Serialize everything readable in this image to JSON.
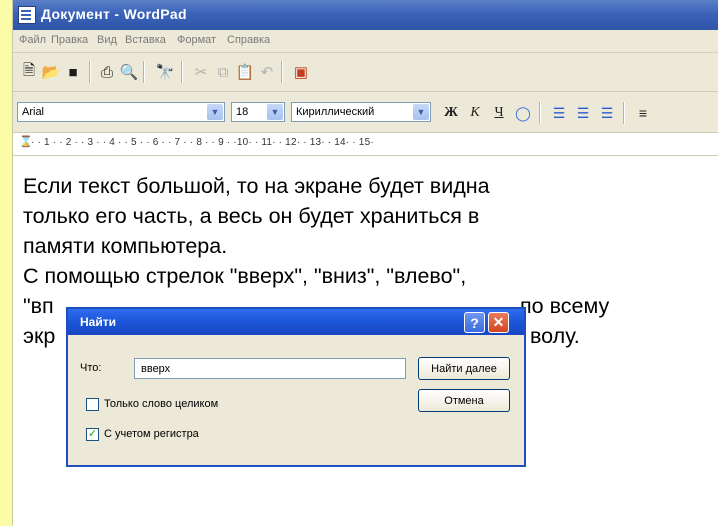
{
  "window": {
    "title": "Документ - WordPad"
  },
  "menu": [
    "Файл",
    "Правка",
    "Вид",
    "Вставка",
    "Формат",
    "Справка"
  ],
  "toolbar": {
    "buttons": [
      "new-icon",
      "open-icon",
      "save-icon",
      "print-icon",
      "print-preview-icon",
      "find-icon",
      "cut-icon",
      "copy-icon",
      "paste-icon",
      "undo-icon",
      "insert-object-icon"
    ]
  },
  "format_bar": {
    "font": "Arial",
    "size": "18",
    "script": "Кириллический",
    "bold_label": "Ж",
    "italic_label": "К",
    "underline_label": "Ч"
  },
  "ruler": {
    "marks": "· · 1 · · 2 · · 3 · · 4 · · 5 · · 6 · · 7 · · 8 · · 9 · ·10· · 11· · 12· · 13· · 14· · 15·"
  },
  "document": {
    "line1": "Если текст большой, то на экране будет видна",
    "line2": "только его часть, а весь он будет храниться в",
    "line3": "памяти компьютера.",
    "line4": "С помощью стрелок \"вверх\", \"вниз\", \"влево\",",
    "line5_start": "\"вп",
    "line5_end": "по всему",
    "line6_start": "экр",
    "line6_end": "волу."
  },
  "find_dialog": {
    "title": "Найти",
    "find_label": "Что:",
    "find_value": "вверх",
    "find_next_label": "Найти далее",
    "cancel_label": "Отмена",
    "whole_word_label": "Только слово целиком",
    "whole_word_checked": false,
    "match_case_label": "С учетом регистра",
    "match_case_checked": true
  }
}
